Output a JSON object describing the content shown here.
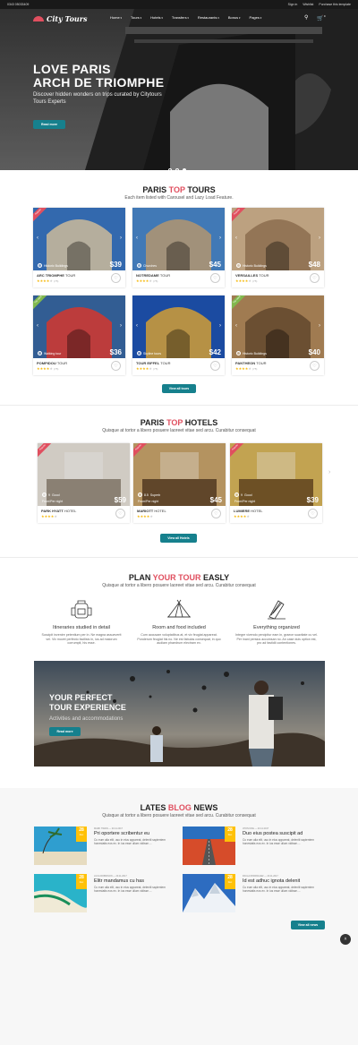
{
  "topbar": {
    "phone": "0343 05033409",
    "sign_in": "Sign in",
    "wishlist": "Wishlist",
    "purchase": "Purchase this template"
  },
  "header": {
    "logo_text": "City Tours",
    "menu": [
      "Home",
      "Tours",
      "Hotels",
      "Transfers",
      "Restaurants",
      "Bonus",
      "Pages"
    ],
    "icons": [
      "search-icon",
      "cart-icon"
    ],
    "cart_count": "0"
  },
  "hero": {
    "title_line1": "LOVE PARIS",
    "title_line2": "ARCH DE TRIOMPHE",
    "subtitle": "Discover hidden wonders on trips curated by Citytours Tours Experts",
    "button": "Read more",
    "slides": 3,
    "active_slide": 2
  },
  "tours_section": {
    "title_pre": "PARIS ",
    "title_accent": "TOP",
    "title_post": " TOURS",
    "subtitle": "Each item listed with Carousel and Lazy Load Feature.",
    "button": "View all tours",
    "tours": [
      {
        "name": "ARC TRIOMPHE",
        "suffix": "TOUR",
        "tag": "Historic Buildings",
        "price": "$39",
        "ribbon": "Popular",
        "ribbon_color": "#e04f5f",
        "stars": 4
      },
      {
        "name": "NOTREDAME",
        "suffix": "TOUR",
        "tag": "Churches",
        "price": "$45",
        "ribbon": "",
        "ribbon_color": "",
        "stars": 4
      },
      {
        "name": "VERSAILLES",
        "suffix": "TOUR",
        "tag": "Historic Buildings",
        "price": "$48",
        "ribbon": "Popular",
        "ribbon_color": "#e04f5f",
        "stars": 4
      },
      {
        "name": "POMPIDOU",
        "suffix": "TOUR",
        "tag": "Walking tour",
        "price": "$36",
        "ribbon": "Top rated",
        "ribbon_color": "#81b84e",
        "stars": 4
      },
      {
        "name": "TOUR EIFFEL",
        "suffix": "TOUR",
        "tag": "Skyline tours",
        "price": "$42",
        "ribbon": "",
        "ribbon_color": "",
        "stars": 4
      },
      {
        "name": "PANTHEON",
        "suffix": "TOUR",
        "tag": "Historic Buildings",
        "price": "$40",
        "ribbon": "Top rated",
        "ribbon_color": "#81b84e",
        "stars": 4
      }
    ],
    "reviews": "(75)"
  },
  "hotels_section": {
    "title_pre": "PARIS ",
    "title_accent": "TOP",
    "title_post": " HOTELS",
    "subtitle": "Quisque at tortor a libero posuere laoreet vitae sed arcu. Curabitur consequat",
    "button": "View all Hotels",
    "per_night": "From/Per night",
    "hotels": [
      {
        "name": "PARK HYATT",
        "suffix": "HOTEL",
        "score": "9",
        "score_label": "Good",
        "price": "$59",
        "ribbon": "Popular",
        "ribbon_color": "#e04f5f",
        "stars": 4
      },
      {
        "name": "MARIOTT",
        "suffix": "HOTEL",
        "score": "8.5",
        "score_label": "Superb",
        "price": "$45",
        "ribbon": "Popular",
        "ribbon_color": "#e04f5f",
        "stars": 4
      },
      {
        "name": "LUMIERE",
        "suffix": "HOTEL",
        "score": "9",
        "score_label": "Good",
        "price": "$39",
        "ribbon": "Popular",
        "ribbon_color": "#e04f5f",
        "stars": 4
      }
    ]
  },
  "plan_section": {
    "title_pre": "PLAN ",
    "title_accent": "YOUR TOUR",
    "title_post": " EASLY",
    "subtitle": "Quisque at tortor a libero posuere laoreet vitae sed arcu. Curabitur consequat",
    "features": [
      {
        "icon": "backpack-icon",
        "title": "Itineraries studied in detail",
        "text": "Suscipit invenire petentium per in. Ne magna assueverit vel. Vix movet perfecto facilisis in, ius ad maiorum corrumpit, his esse."
      },
      {
        "icon": "tent-icon",
        "title": "Room and food included",
        "text": "Cum accusam voluptatibus at, et vix feugiat appareat. Ponderum feugiat his no. Ne est fabulas consequat, in quo audiam phaedrum electram ex."
      },
      {
        "icon": "compass-icon",
        "title": "Everything organized",
        "text": "Integre vivendo percipitur eam in, graece suavitate cu vel. Per inani persius accumsan no. An case duis option est, pro ad fastidii contentiones."
      }
    ],
    "banner": {
      "title_line1": "YOUR PERFECT",
      "title_line2": "TOUR EXPERIENCE",
      "subtitle": "Activities and accommodations",
      "button": "Read more"
    }
  },
  "blog_section": {
    "title_pre": "LATES ",
    "title_accent": "BLOG",
    "title_post": " NEWS",
    "subtitle": "Quisque at tortor a libero posuere laoreet vitae sed arcu. Curabitur consequat",
    "button": "View all news",
    "posts": [
      {
        "day": "28",
        "month": "Dec",
        "meta": "MARK TWAIN  —  20.11.2017",
        "title": "Pri oportere scribentur eu",
        "text": "Cu eum alia elit, usu in eius appareat, deleniti sapientem honestatis eos ex. In ius esse ullum vidisse...."
      },
      {
        "day": "28",
        "month": "Dec",
        "meta": "JHON DOE  —  20.11.2017",
        "title": "Duo eius postea suscipit ad",
        "text": "Cu eum alia elit, usu in eius appareat, deleniti sapientem honestatis eos ex. In ius esse ullum vidisse...."
      },
      {
        "day": "28",
        "month": "Dec",
        "meta": "LUCA ROBINSON  —  20.11.2017",
        "title": "Elitr mandamus cu has",
        "text": "Cu eum alia elit, usu in eius appareat, deleniti sapientem honestatis eos ex. In ius esse ullum vidisse...."
      },
      {
        "day": "28",
        "month": "Dec",
        "meta": "PAULA RODRIGUEZ  —  20.11.2017",
        "title": "Id est adhuc ignota delenit",
        "text": "Cu eum alia elit, usu in eius appareat, deleniti sapientem honestatis eos ex. In ius esse ullum vidisse...."
      }
    ]
  },
  "colors": {
    "accent_red": "#e04f5f",
    "teal_button": "#16808d",
    "star": "#f5b80a",
    "date_badge": "#ffc107",
    "green_ribbon": "#81b84e"
  }
}
